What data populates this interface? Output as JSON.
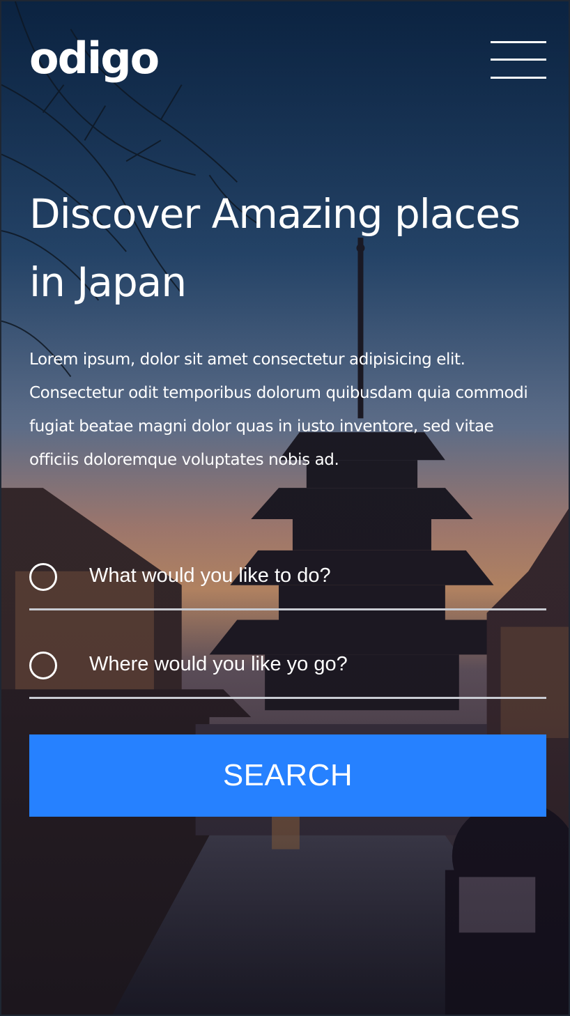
{
  "header": {
    "logo_text": "odigo",
    "menu_icon": "hamburger-menu-icon"
  },
  "hero": {
    "title": "Discover Amazing places in Japan",
    "description": "Lorem ipsum, dolor sit amet consectetur adipisicing elit. Consectetur odit temporibus dolorum quibusdam quia commodi fugiat beatae magni dolor quas in iusto inventore, sed vitae officiis doloremque voluptates nobis ad."
  },
  "search_form": {
    "activity_placeholder": "What would you like to do?",
    "destination_placeholder": "Where would you like yo go?",
    "search_label": "SEARCH"
  },
  "colors": {
    "accent": "#2681ff",
    "field_underline": "#c9ccd3",
    "text": "#ffffff"
  }
}
